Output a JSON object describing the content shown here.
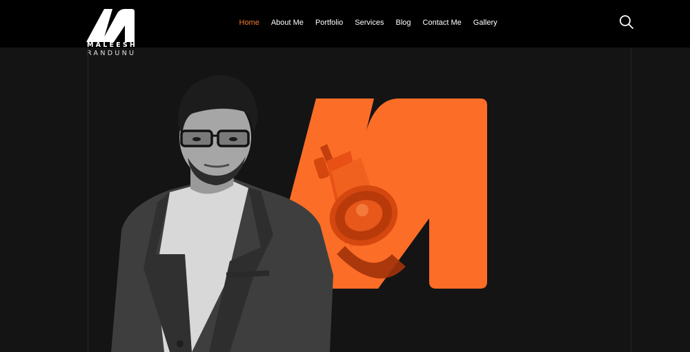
{
  "brand": {
    "name_line1": "MALEESH",
    "name_line2": "RANDUNU",
    "accent_color": "#f47a2f"
  },
  "nav": {
    "items": [
      {
        "label": "Home",
        "active": true
      },
      {
        "label": "About Me",
        "active": false
      },
      {
        "label": "Portfolio",
        "active": false
      },
      {
        "label": "Services",
        "active": false
      },
      {
        "label": "Blog",
        "active": false
      },
      {
        "label": "Contact Me",
        "active": false
      },
      {
        "label": "Gallery",
        "active": false
      }
    ]
  },
  "icons": {
    "search": "search-icon",
    "megaphone": "megaphone-icon"
  },
  "hero": {
    "background": "#141414",
    "letter_color": "#fc6d27"
  }
}
